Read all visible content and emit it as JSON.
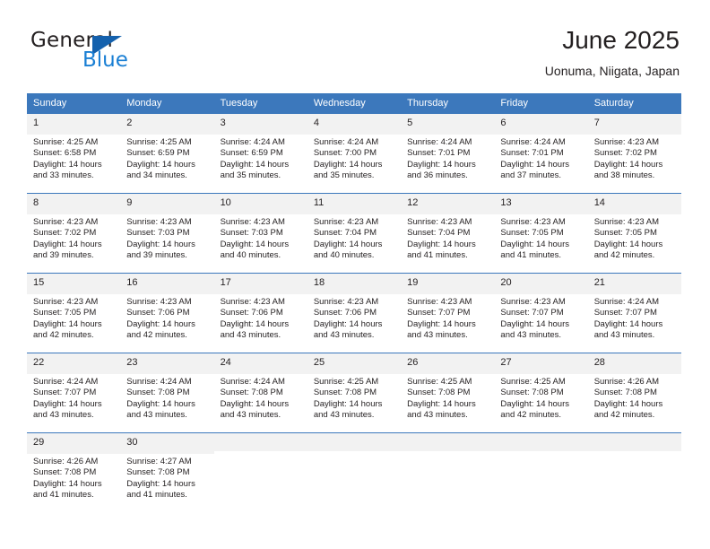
{
  "brand": {
    "name_part1": "General",
    "name_part2": "Blue",
    "accent_color": "#1a7fd4",
    "triangle_color": "#1461ad"
  },
  "header": {
    "title": "June 2025",
    "location": "Uonuma, Niigata, Japan"
  },
  "theme": {
    "header_bg": "#3c78bc",
    "daynum_band": "#f2f2f2",
    "text": "#231f20"
  },
  "weekday_headers": [
    "Sunday",
    "Monday",
    "Tuesday",
    "Wednesday",
    "Thursday",
    "Friday",
    "Saturday"
  ],
  "weeks": [
    [
      {
        "day": "1",
        "sunrise": "Sunrise: 4:25 AM",
        "sunset": "Sunset: 6:58 PM",
        "daylight1": "Daylight: 14 hours",
        "daylight2": "and 33 minutes."
      },
      {
        "day": "2",
        "sunrise": "Sunrise: 4:25 AM",
        "sunset": "Sunset: 6:59 PM",
        "daylight1": "Daylight: 14 hours",
        "daylight2": "and 34 minutes."
      },
      {
        "day": "3",
        "sunrise": "Sunrise: 4:24 AM",
        "sunset": "Sunset: 6:59 PM",
        "daylight1": "Daylight: 14 hours",
        "daylight2": "and 35 minutes."
      },
      {
        "day": "4",
        "sunrise": "Sunrise: 4:24 AM",
        "sunset": "Sunset: 7:00 PM",
        "daylight1": "Daylight: 14 hours",
        "daylight2": "and 35 minutes."
      },
      {
        "day": "5",
        "sunrise": "Sunrise: 4:24 AM",
        "sunset": "Sunset: 7:01 PM",
        "daylight1": "Daylight: 14 hours",
        "daylight2": "and 36 minutes."
      },
      {
        "day": "6",
        "sunrise": "Sunrise: 4:24 AM",
        "sunset": "Sunset: 7:01 PM",
        "daylight1": "Daylight: 14 hours",
        "daylight2": "and 37 minutes."
      },
      {
        "day": "7",
        "sunrise": "Sunrise: 4:23 AM",
        "sunset": "Sunset: 7:02 PM",
        "daylight1": "Daylight: 14 hours",
        "daylight2": "and 38 minutes."
      }
    ],
    [
      {
        "day": "8",
        "sunrise": "Sunrise: 4:23 AM",
        "sunset": "Sunset: 7:02 PM",
        "daylight1": "Daylight: 14 hours",
        "daylight2": "and 39 minutes."
      },
      {
        "day": "9",
        "sunrise": "Sunrise: 4:23 AM",
        "sunset": "Sunset: 7:03 PM",
        "daylight1": "Daylight: 14 hours",
        "daylight2": "and 39 minutes."
      },
      {
        "day": "10",
        "sunrise": "Sunrise: 4:23 AM",
        "sunset": "Sunset: 7:03 PM",
        "daylight1": "Daylight: 14 hours",
        "daylight2": "and 40 minutes."
      },
      {
        "day": "11",
        "sunrise": "Sunrise: 4:23 AM",
        "sunset": "Sunset: 7:04 PM",
        "daylight1": "Daylight: 14 hours",
        "daylight2": "and 40 minutes."
      },
      {
        "day": "12",
        "sunrise": "Sunrise: 4:23 AM",
        "sunset": "Sunset: 7:04 PM",
        "daylight1": "Daylight: 14 hours",
        "daylight2": "and 41 minutes."
      },
      {
        "day": "13",
        "sunrise": "Sunrise: 4:23 AM",
        "sunset": "Sunset: 7:05 PM",
        "daylight1": "Daylight: 14 hours",
        "daylight2": "and 41 minutes."
      },
      {
        "day": "14",
        "sunrise": "Sunrise: 4:23 AM",
        "sunset": "Sunset: 7:05 PM",
        "daylight1": "Daylight: 14 hours",
        "daylight2": "and 42 minutes."
      }
    ],
    [
      {
        "day": "15",
        "sunrise": "Sunrise: 4:23 AM",
        "sunset": "Sunset: 7:05 PM",
        "daylight1": "Daylight: 14 hours",
        "daylight2": "and 42 minutes."
      },
      {
        "day": "16",
        "sunrise": "Sunrise: 4:23 AM",
        "sunset": "Sunset: 7:06 PM",
        "daylight1": "Daylight: 14 hours",
        "daylight2": "and 42 minutes."
      },
      {
        "day": "17",
        "sunrise": "Sunrise: 4:23 AM",
        "sunset": "Sunset: 7:06 PM",
        "daylight1": "Daylight: 14 hours",
        "daylight2": "and 43 minutes."
      },
      {
        "day": "18",
        "sunrise": "Sunrise: 4:23 AM",
        "sunset": "Sunset: 7:06 PM",
        "daylight1": "Daylight: 14 hours",
        "daylight2": "and 43 minutes."
      },
      {
        "day": "19",
        "sunrise": "Sunrise: 4:23 AM",
        "sunset": "Sunset: 7:07 PM",
        "daylight1": "Daylight: 14 hours",
        "daylight2": "and 43 minutes."
      },
      {
        "day": "20",
        "sunrise": "Sunrise: 4:23 AM",
        "sunset": "Sunset: 7:07 PM",
        "daylight1": "Daylight: 14 hours",
        "daylight2": "and 43 minutes."
      },
      {
        "day": "21",
        "sunrise": "Sunrise: 4:24 AM",
        "sunset": "Sunset: 7:07 PM",
        "daylight1": "Daylight: 14 hours",
        "daylight2": "and 43 minutes."
      }
    ],
    [
      {
        "day": "22",
        "sunrise": "Sunrise: 4:24 AM",
        "sunset": "Sunset: 7:07 PM",
        "daylight1": "Daylight: 14 hours",
        "daylight2": "and 43 minutes."
      },
      {
        "day": "23",
        "sunrise": "Sunrise: 4:24 AM",
        "sunset": "Sunset: 7:08 PM",
        "daylight1": "Daylight: 14 hours",
        "daylight2": "and 43 minutes."
      },
      {
        "day": "24",
        "sunrise": "Sunrise: 4:24 AM",
        "sunset": "Sunset: 7:08 PM",
        "daylight1": "Daylight: 14 hours",
        "daylight2": "and 43 minutes."
      },
      {
        "day": "25",
        "sunrise": "Sunrise: 4:25 AM",
        "sunset": "Sunset: 7:08 PM",
        "daylight1": "Daylight: 14 hours",
        "daylight2": "and 43 minutes."
      },
      {
        "day": "26",
        "sunrise": "Sunrise: 4:25 AM",
        "sunset": "Sunset: 7:08 PM",
        "daylight1": "Daylight: 14 hours",
        "daylight2": "and 43 minutes."
      },
      {
        "day": "27",
        "sunrise": "Sunrise: 4:25 AM",
        "sunset": "Sunset: 7:08 PM",
        "daylight1": "Daylight: 14 hours",
        "daylight2": "and 42 minutes."
      },
      {
        "day": "28",
        "sunrise": "Sunrise: 4:26 AM",
        "sunset": "Sunset: 7:08 PM",
        "daylight1": "Daylight: 14 hours",
        "daylight2": "and 42 minutes."
      }
    ],
    [
      {
        "day": "29",
        "sunrise": "Sunrise: 4:26 AM",
        "sunset": "Sunset: 7:08 PM",
        "daylight1": "Daylight: 14 hours",
        "daylight2": "and 41 minutes."
      },
      {
        "day": "30",
        "sunrise": "Sunrise: 4:27 AM",
        "sunset": "Sunset: 7:08 PM",
        "daylight1": "Daylight: 14 hours",
        "daylight2": "and 41 minutes."
      },
      {
        "day": "",
        "sunrise": "",
        "sunset": "",
        "daylight1": "",
        "daylight2": ""
      },
      {
        "day": "",
        "sunrise": "",
        "sunset": "",
        "daylight1": "",
        "daylight2": ""
      },
      {
        "day": "",
        "sunrise": "",
        "sunset": "",
        "daylight1": "",
        "daylight2": ""
      },
      {
        "day": "",
        "sunrise": "",
        "sunset": "",
        "daylight1": "",
        "daylight2": ""
      },
      {
        "day": "",
        "sunrise": "",
        "sunset": "",
        "daylight1": "",
        "daylight2": ""
      }
    ]
  ]
}
